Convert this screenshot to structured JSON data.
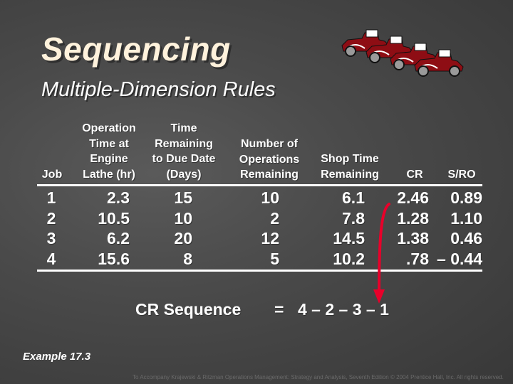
{
  "slide": {
    "title": "Sequencing",
    "subtitle": "Multiple-Dimension Rules",
    "decoration_icon": "vintage-cars-icon",
    "accent_color": "#e8002a",
    "title_color": "#fff2dc"
  },
  "table": {
    "headers": [
      {
        "lines": [
          "Job"
        ]
      },
      {
        "lines": [
          "Operation",
          "Time at",
          "Engine",
          "Lathe (hr)"
        ]
      },
      {
        "lines": [
          "Time",
          "Remaining",
          "to Due Date",
          "(Days)"
        ]
      },
      {
        "lines": [
          "Number of",
          "Operations",
          "Remaining"
        ]
      },
      {
        "lines": [
          "Shop Time",
          "Remaining"
        ]
      },
      {
        "lines": [
          "CR"
        ]
      },
      {
        "lines": [
          "S/RO"
        ]
      }
    ],
    "columns": [
      [
        "1",
        "2",
        "3",
        "4"
      ],
      [
        "2.3",
        "10.5",
        "6.2",
        "15.6"
      ],
      [
        "15",
        "10",
        "20",
        "8"
      ],
      [
        "10",
        "2",
        "12",
        "5"
      ],
      [
        "6.1",
        "7.8",
        "14.5",
        "10.2"
      ],
      [
        "2.46",
        "1.28",
        "1.38",
        ".78"
      ],
      [
        "0.89",
        "1.10",
        "0.46",
        "– 0.44"
      ]
    ]
  },
  "sequence": {
    "label": "CR Sequence",
    "equals": "=",
    "value": "4 – 2 – 3 – 1"
  },
  "example_label": "Example 17.3",
  "footer": "To Accompany Krajewski & Ritzman Operations Management: Strategy and Analysis, Seventh Edition © 2004 Prentice Hall, Inc. All rights reserved."
}
